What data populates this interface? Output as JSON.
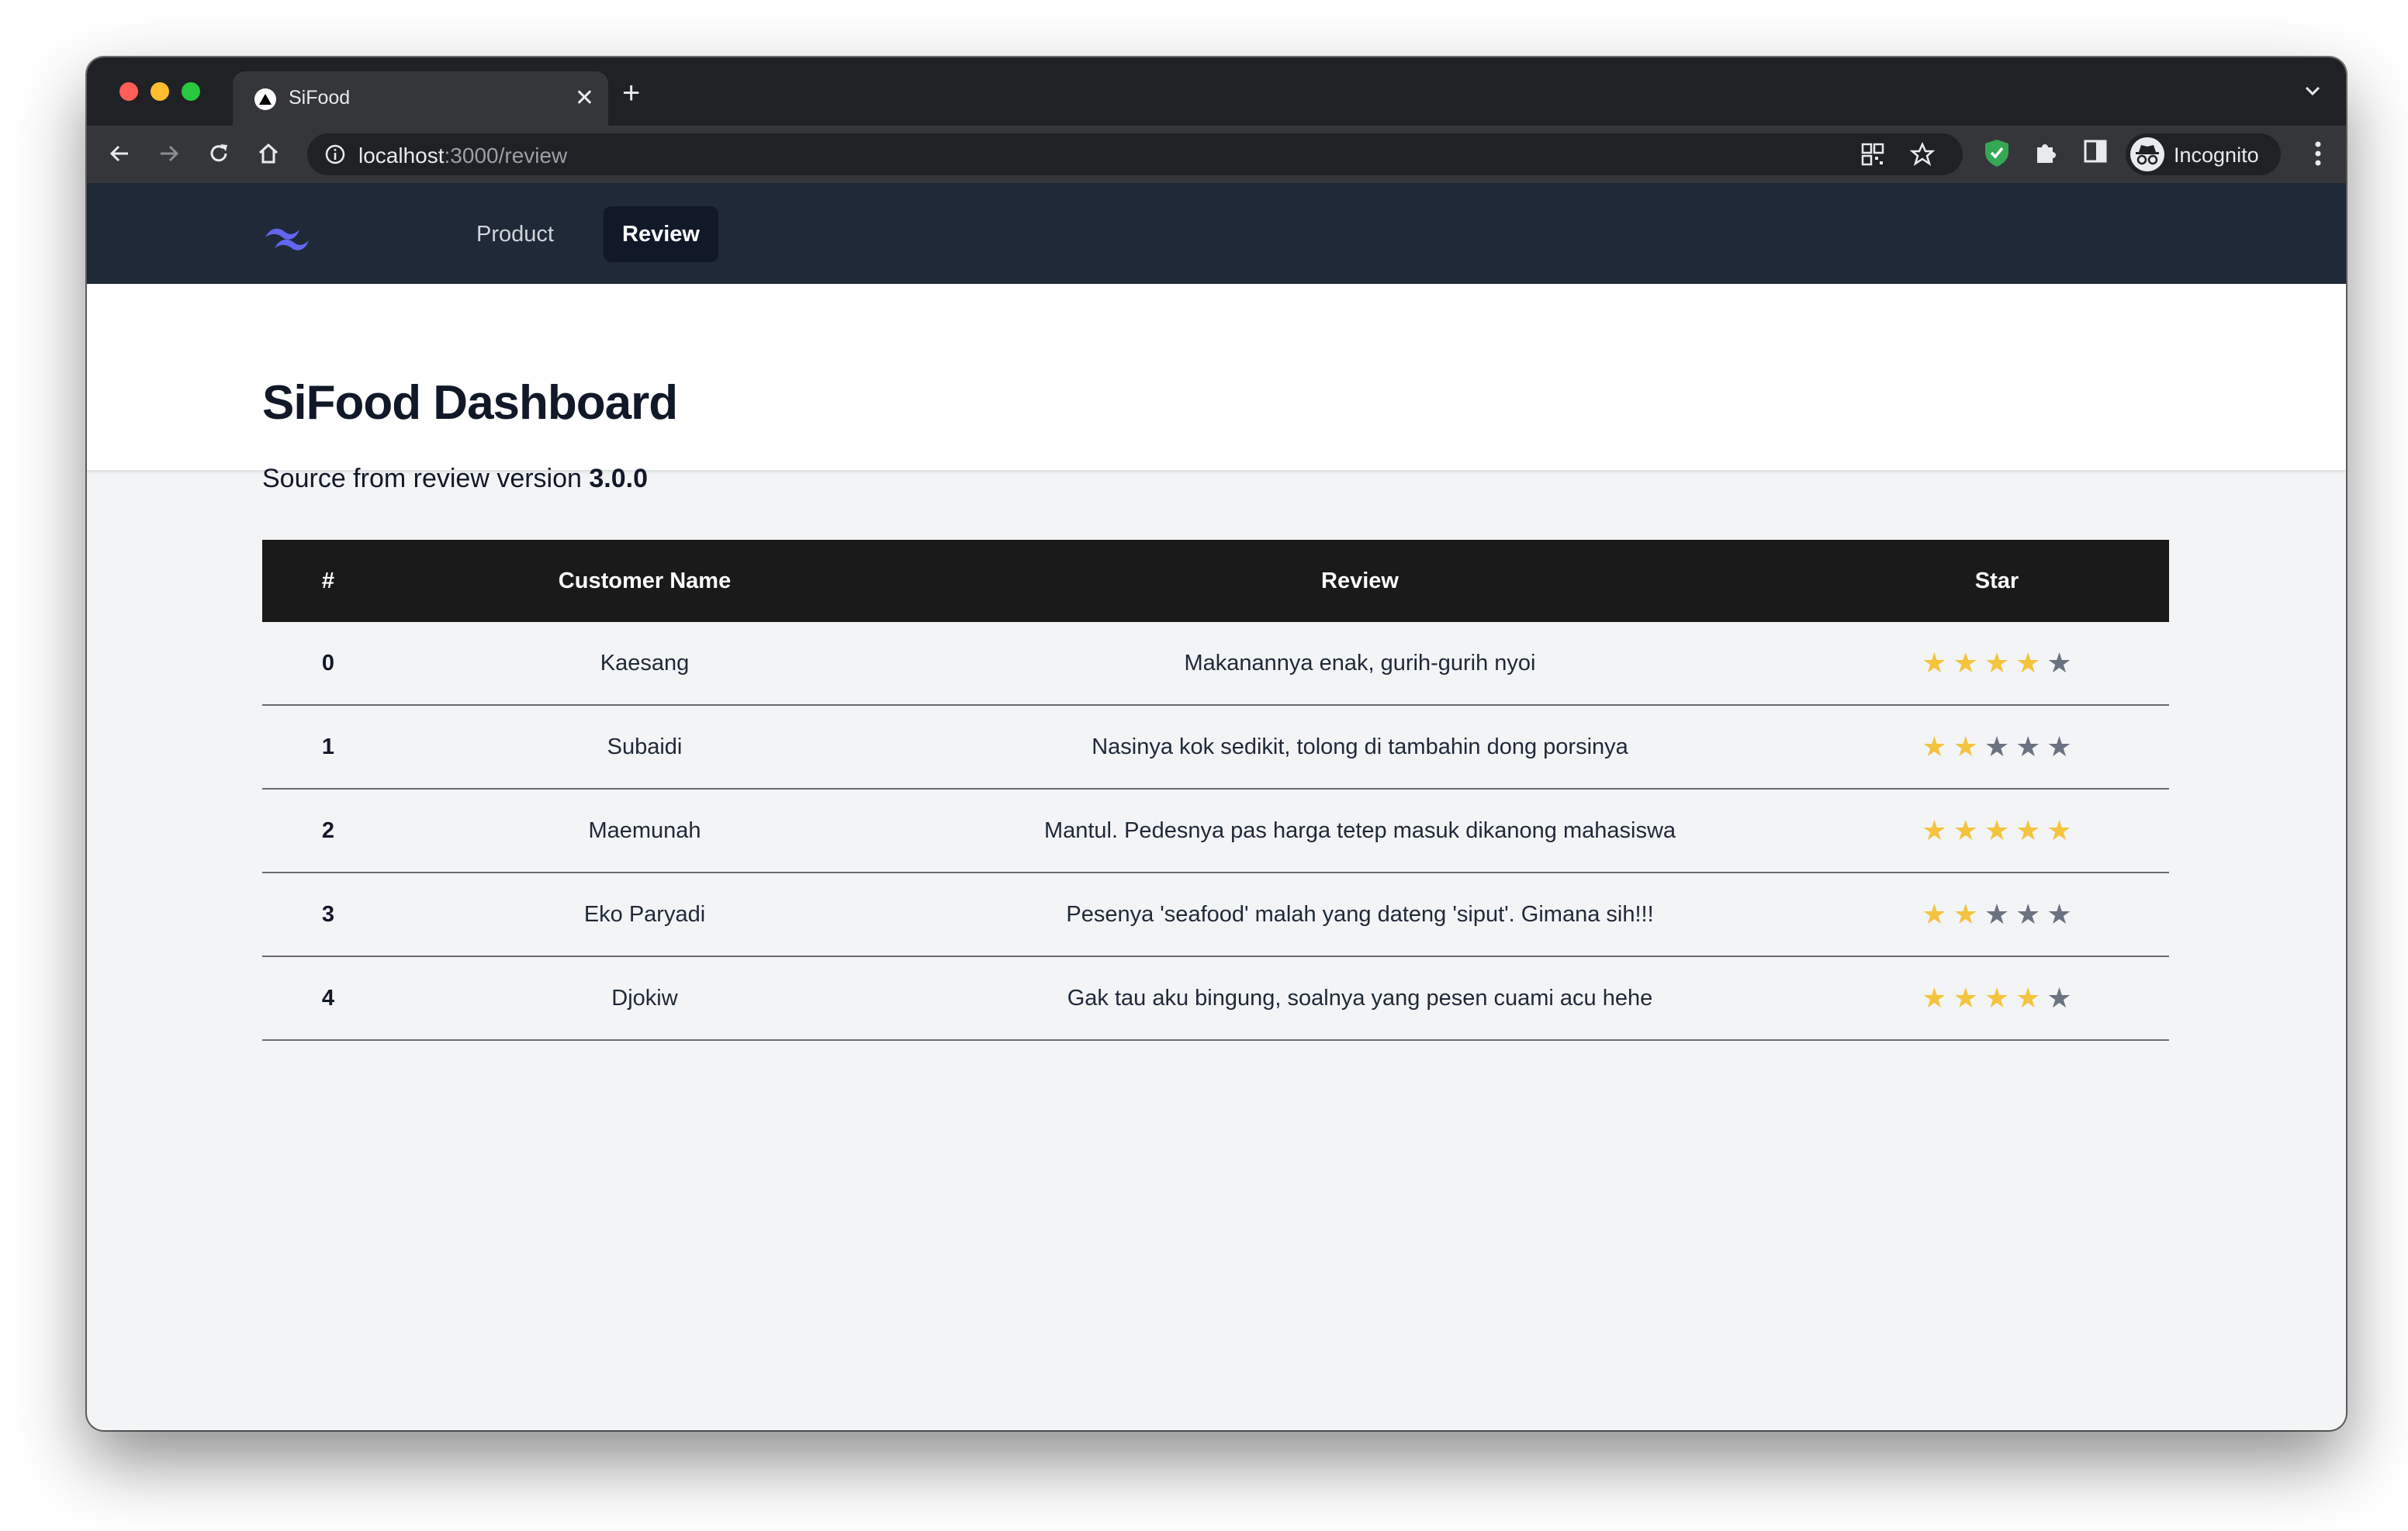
{
  "browser": {
    "tab_title": "SiFood",
    "url_host": "localhost",
    "url_path": ":3000/review",
    "profile_label": "Incognito"
  },
  "nav": {
    "items": [
      {
        "label": "Product",
        "active": false
      },
      {
        "label": "Review",
        "active": true
      }
    ]
  },
  "header": {
    "title": "SiFood Dashboard"
  },
  "source": {
    "prefix": "Source from review version",
    "version": "3.0.0"
  },
  "table": {
    "columns": [
      "#",
      "Customer Name",
      "Review",
      "Star"
    ],
    "rows": [
      {
        "index": "0",
        "name": "Kaesang",
        "review": "Makanannya enak, gurih-gurih nyoi",
        "stars": 4
      },
      {
        "index": "1",
        "name": "Subaidi",
        "review": "Nasinya kok sedikit, tolong di tambahin dong porsinya",
        "stars": 2
      },
      {
        "index": "2",
        "name": "Maemunah",
        "review": "Mantul. Pedesnya pas harga tetep masuk dikanong mahasiswa",
        "stars": 5
      },
      {
        "index": "3",
        "name": "Eko Paryadi",
        "review": "Pesenya 'seafood' malah yang dateng 'siput'. Gimana sih!!!",
        "stars": 2
      },
      {
        "index": "4",
        "name": "Djokiw",
        "review": "Gak tau aku bingung, soalnya yang pesen cuami acu hehe",
        "stars": 4
      }
    ],
    "max_stars": 5
  },
  "colors": {
    "star_on": "#f4c43f",
    "star_off": "#6b7280",
    "navbar": "#1f2937",
    "table_header": "#1a1a1a"
  }
}
